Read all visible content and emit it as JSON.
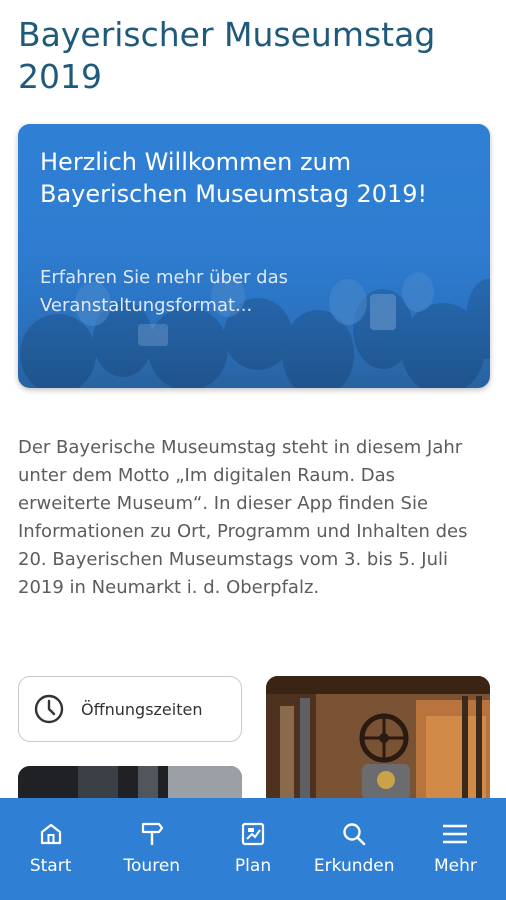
{
  "page": {
    "title": "Bayerischer Museumstag 2019"
  },
  "hero": {
    "title": "Herzlich Willkommen zum Bayerischen Museumstag 2019!",
    "subtitle": "Erfahren Sie mehr über das Veranstaltungsformat..."
  },
  "intro": {
    "text": "Der Bayerische Museumstag steht in diesem Jahr unter dem Motto „Im digitalen Raum. Das erweiterte Museum“. In dieser App finden Sie Informationen zu Ort, Programm und Inhalten des 20. Bayerischen Museumstags vom 3. bis 5. Juli 2019 in Neumarkt i. d. Oberpfalz."
  },
  "cards": {
    "hours_label": "Öffnungszeiten",
    "hours_icon": "clock-icon"
  },
  "tabbar": {
    "background": "#2f7fd4",
    "items": [
      {
        "label": "Start",
        "icon": "home-icon"
      },
      {
        "label": "Touren",
        "icon": "signpost-icon"
      },
      {
        "label": "Plan",
        "icon": "map-icon"
      },
      {
        "label": "Erkunden",
        "icon": "search-icon"
      },
      {
        "label": "Mehr",
        "icon": "menu-icon"
      }
    ]
  }
}
